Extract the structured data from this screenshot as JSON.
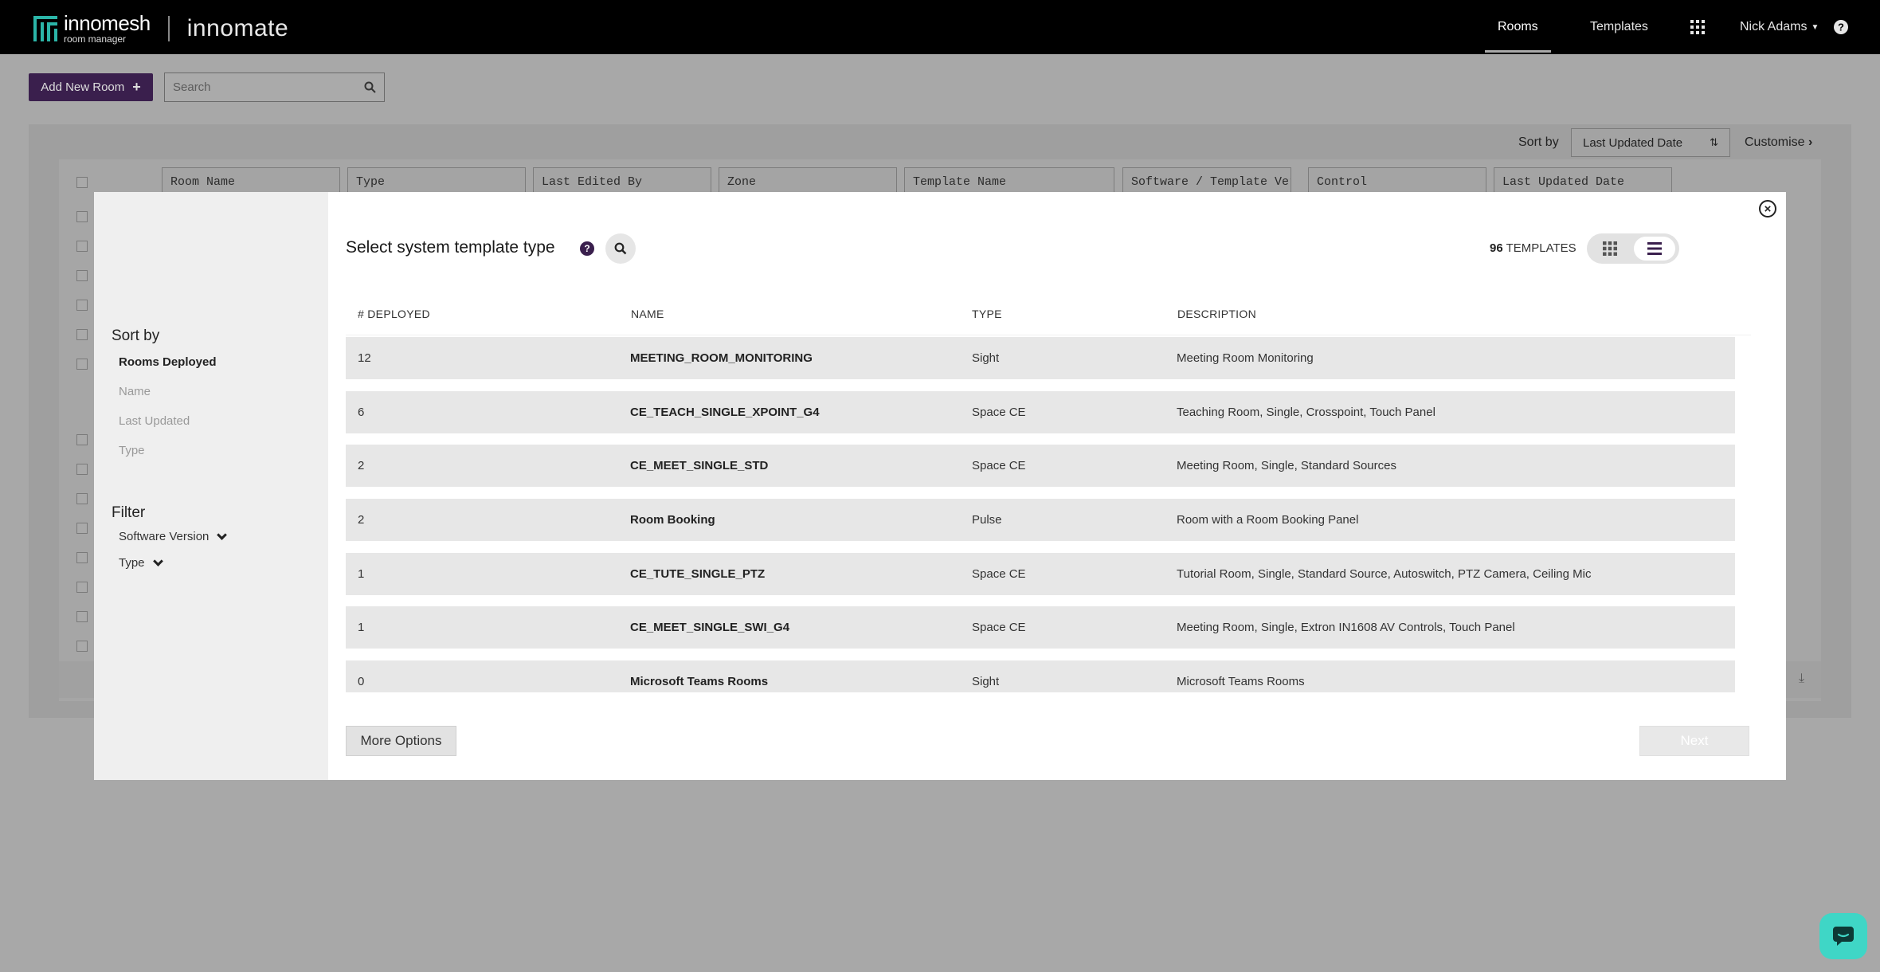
{
  "header": {
    "logo_name": "innomesh",
    "logo_sub": "room manager",
    "app_name": "innomate",
    "nav": {
      "rooms": "Rooms",
      "templates": "Templates",
      "user": "Nick Adams",
      "grid_icon": "apps-grid-icon",
      "help_icon": "help-circle-icon"
    }
  },
  "toolbar": {
    "add_label": "Add New Room",
    "search_placeholder": "Search"
  },
  "list": {
    "sort_label": "Sort by",
    "sort_value": "Last Updated Date",
    "customise_label": "Customise",
    "column_filters": [
      "Room Name",
      "Type",
      "Last Edited By",
      "Zone",
      "Template Name",
      "Software / Template Ver",
      "Control",
      "Last Updated Date"
    ]
  },
  "modal": {
    "title": "Select system template type",
    "count_number": "96",
    "count_label": "TEMPLATES",
    "sidebar": {
      "sort_heading": "Sort by",
      "sort_options": [
        "Rooms Deployed",
        "Name",
        "Last Updated",
        "Type"
      ],
      "active_sort": "Rooms Deployed",
      "filter_heading": "Filter",
      "filter_options": [
        "Software Version",
        "Type"
      ]
    },
    "columns": [
      "# DEPLOYED",
      "NAME",
      "TYPE",
      "DESCRIPTION"
    ],
    "rows": [
      {
        "deployed": "12",
        "name": "MEETING_ROOM_MONITORING",
        "type": "Sight",
        "description": "Meeting Room Monitoring"
      },
      {
        "deployed": "6",
        "name": "CE_TEACH_SINGLE_XPOINT_G4",
        "type": "Space CE",
        "description": "Teaching Room, Single, Crosspoint, Touch Panel"
      },
      {
        "deployed": "2",
        "name": "CE_MEET_SINGLE_STD",
        "type": "Space CE",
        "description": "Meeting Room, Single, Standard Sources"
      },
      {
        "deployed": "2",
        "name": "Room Booking",
        "type": "Pulse",
        "description": "Room with a Room Booking Panel"
      },
      {
        "deployed": "1",
        "name": "CE_TUTE_SINGLE_PTZ",
        "type": "Space CE",
        "description": "Tutorial Room, Single, Standard Source, Autoswitch, PTZ Camera, Ceiling Mic"
      },
      {
        "deployed": "1",
        "name": "CE_MEET_SINGLE_SWI_G4",
        "type": "Space CE",
        "description": "Meeting Room, Single, Extron IN1608 AV Controls, Touch Panel"
      },
      {
        "deployed": "0",
        "name": "Microsoft Teams Rooms",
        "type": "Sight",
        "description": "Microsoft Teams Rooms"
      }
    ],
    "more_options_label": "More Options",
    "next_label": "Next"
  },
  "colors": {
    "brand_purple": "#3a1f4d",
    "brand_teal": "#2bb5a8",
    "chat_teal": "#3fd6c6"
  }
}
